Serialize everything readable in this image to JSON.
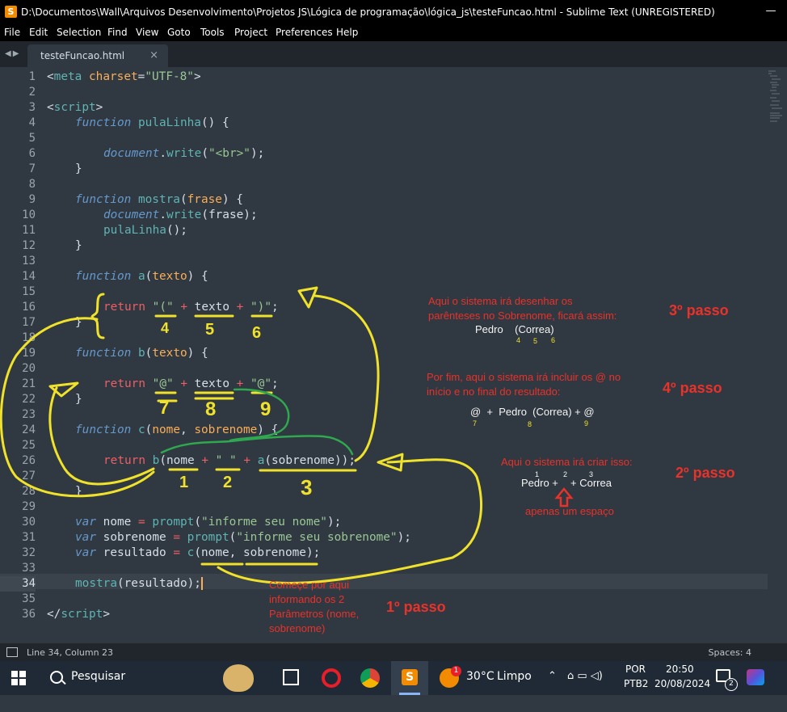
{
  "window": {
    "title": "D:\\Documentos\\Wall\\Arquivos Desenvolvimento\\Projetos JS\\Lógica de programação\\lógica_js\\testeFuncao.html - Sublime Text (UNREGISTERED)",
    "app_icon": "sublime-text-icon"
  },
  "menu": [
    "File",
    "Edit",
    "Selection",
    "Find",
    "View",
    "Goto",
    "Tools",
    "Project",
    "Preferences",
    "Help"
  ],
  "tab": {
    "label": "testeFuncao.html",
    "close": "×"
  },
  "gutter": [
    "1",
    "2",
    "3",
    "4",
    "5",
    "6",
    "7",
    "8",
    "9",
    "10",
    "11",
    "12",
    "13",
    "14",
    "15",
    "16",
    "17",
    "18",
    "19",
    "20",
    "21",
    "22",
    "23",
    "24",
    "25",
    "26",
    "27",
    "28",
    "29",
    "30",
    "31",
    "32",
    "33",
    "34",
    "35",
    "36"
  ],
  "active_line": 34,
  "code": {
    "l1": {
      "a": "<",
      "b": "meta",
      "c": " ",
      "d": "charset",
      "e": "=",
      "f": "\"UTF-8\"",
      "g": ">"
    },
    "l3": {
      "a": "<",
      "b": "script",
      "c": ">"
    },
    "l4": {
      "kw": "function",
      "name": "pulaLinha",
      "rest": "() {"
    },
    "l6": {
      "obj": "document",
      "dot": ".",
      "m": "write",
      "p1": "(",
      "s": "\"<br>\"",
      "p2": ");"
    },
    "l7": "}",
    "l9": {
      "kw": "function",
      "name": "mostra",
      "p1": "(",
      "arg": "frase",
      "p2": ") {"
    },
    "l10": {
      "obj": "document",
      "dot": ".",
      "m": "write",
      "rest": "(frase);"
    },
    "l11": {
      "m": "pulaLinha",
      "rest": "();"
    },
    "l12": "}",
    "l14": {
      "kw": "function",
      "name": "a",
      "p1": "(",
      "arg": "texto",
      "p2": ") {"
    },
    "l16": {
      "ret": "return",
      "s1": "\"(\"",
      "plus1": "+",
      "v": "texto",
      "plus2": "+",
      "s2": "\")\"",
      "semi": ";"
    },
    "l17": "}",
    "l19": {
      "kw": "function",
      "name": "b",
      "p1": "(",
      "arg": "texto",
      "p2": ") {"
    },
    "l21": {
      "ret": "return",
      "s1": "\"@\"",
      "plus1": "+",
      "v": "texto",
      "plus2": "+",
      "s2": "\"@\"",
      "semi": ";"
    },
    "l22": "}",
    "l24": {
      "kw": "function",
      "name": "c",
      "p1": "(",
      "arg1": "nome",
      "comma": ", ",
      "arg2": "sobrenome",
      "p2": ") {"
    },
    "l26": {
      "ret": "return",
      "b": "b",
      "p1": "(nome",
      "plus1": "+",
      "s": "\" \"",
      "plus2": "+",
      "a": "a",
      "rest": "(sobrenome));"
    },
    "l28": "}",
    "l30": {
      "kw": "var",
      "v": "nome",
      "eq": "=",
      "f": "prompt",
      "p1": "(",
      "s": "\"informe seu nome\"",
      "p2": ");"
    },
    "l31": {
      "kw": "var",
      "v": "sobrenome",
      "eq": "=",
      "f": "prompt",
      "p1": "(",
      "s": "\"informe seu sobrenome\"",
      "p2": ");"
    },
    "l32": {
      "kw": "var",
      "v": "resultado",
      "eq": "=",
      "f": "c",
      "rest": "(nome, sobrenome);"
    },
    "l34": {
      "f": "mostra",
      "rest": "(resultado);"
    },
    "l36": {
      "a": "</",
      "b": "script",
      "c": ">"
    }
  },
  "annotations": {
    "step3_text": [
      "Aqui o sistema irá desenhar os",
      "parênteses no Sobrenome, ficará assim:"
    ],
    "step3_example": "Pedro    (Correa)",
    "step3_nums": [
      "4",
      "5",
      "6"
    ],
    "step3_label": "3º passo",
    "step4_text": [
      "Por fim, aqui o sistema irá incluir os @ no",
      "início e no final do resultado:"
    ],
    "step4_example": "@  +  Pedro  (Correa) + @",
    "step4_nums": [
      "7",
      "8",
      "9"
    ],
    "step4_label": "4º passo",
    "step2_text": "Aqui o sistema irá criar isso:",
    "step2_nums": [
      "1",
      "2",
      "3"
    ],
    "step2_example_a": "Pedro +",
    "step2_example_b": "+ Correa",
    "step2_note": "apenas um espaço",
    "step2_label": "2º passo",
    "step1_text": [
      "Começe por aqui",
      "informando os 2",
      "Parâmetros (nome,",
      "sobrenome)"
    ],
    "step1_label": "1º passo",
    "hand_nums": [
      "4",
      "5",
      "6",
      "7",
      "8",
      "9",
      "1",
      "2",
      "3"
    ]
  },
  "status": {
    "position": "Line 34, Column 23",
    "spaces": "Spaces: 4"
  },
  "taskbar": {
    "search_placeholder": "Pesquisar",
    "weather_temp": "30°C",
    "weather_desc": "Limpo",
    "weather_badge": "1",
    "lang": "POR",
    "layout": "PTB2",
    "time": "20:50",
    "date": "20/08/2024",
    "notif_count": "2"
  },
  "colors": {
    "bg": "#303841",
    "keyword": "#6699cc",
    "function": "#5fb4b4",
    "string": "#99c794",
    "param": "#f9ae58",
    "operator": "#ec5f66",
    "annotation_red": "#e8322a",
    "annotation_yellow": "#f0e22b",
    "annotation_green": "#2fa84f"
  }
}
